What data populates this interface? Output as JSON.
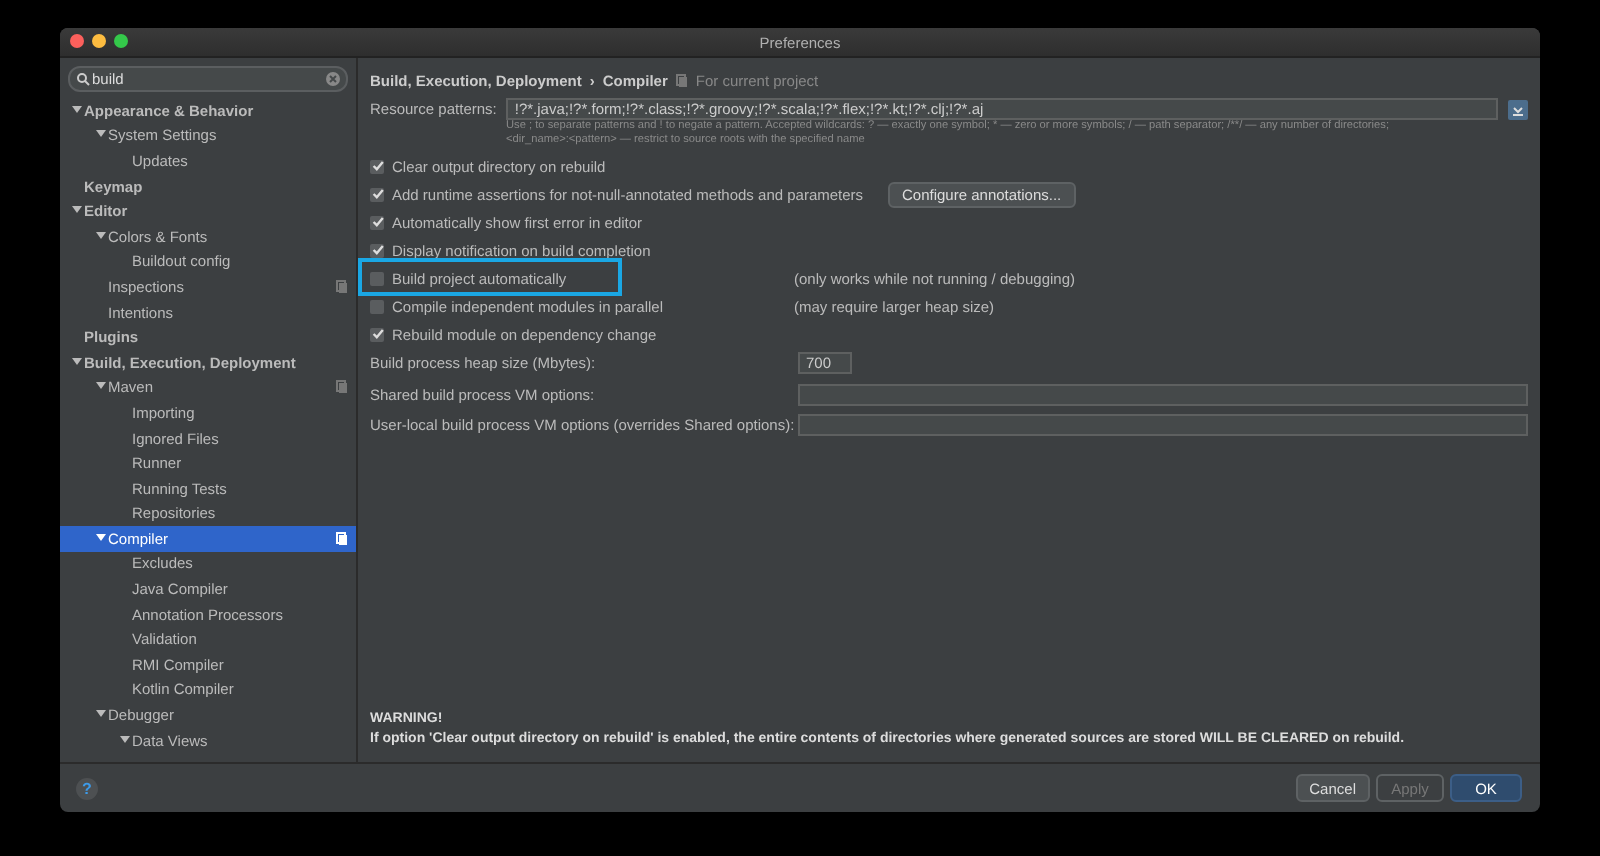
{
  "window": {
    "title": "Preferences"
  },
  "search": {
    "value": "build"
  },
  "tree": [
    {
      "label": "Appearance & Behavior",
      "expanded": true,
      "selected": false,
      "project_icon": false,
      "children": [
        {
          "label": "System Settings",
          "expanded": true,
          "selected": false,
          "project_icon": false,
          "children": [
            {
              "label": "Updates",
              "selected": false,
              "project_icon": false
            }
          ]
        }
      ]
    },
    {
      "label": "Keymap",
      "selected": false,
      "project_icon": false
    },
    {
      "label": "Editor",
      "expanded": true,
      "selected": false,
      "project_icon": false,
      "children": [
        {
          "label": "Colors & Fonts",
          "expanded": true,
          "selected": false,
          "project_icon": false,
          "children": [
            {
              "label": "Buildout config",
              "selected": false,
              "project_icon": false
            }
          ]
        },
        {
          "label": "Inspections",
          "selected": false,
          "project_icon": true
        },
        {
          "label": "Intentions",
          "selected": false,
          "project_icon": false
        }
      ]
    },
    {
      "label": "Plugins",
      "selected": false,
      "project_icon": false
    },
    {
      "label": "Build, Execution, Deployment",
      "expanded": true,
      "selected": false,
      "project_icon": false,
      "children": [
        {
          "label": "Maven",
          "expanded": true,
          "selected": false,
          "project_icon": true,
          "children": [
            {
              "label": "Importing",
              "selected": false,
              "project_icon": false
            },
            {
              "label": "Ignored Files",
              "selected": false,
              "project_icon": false
            },
            {
              "label": "Runner",
              "selected": false,
              "project_icon": false
            },
            {
              "label": "Running Tests",
              "selected": false,
              "project_icon": false
            },
            {
              "label": "Repositories",
              "selected": false,
              "project_icon": false
            }
          ]
        },
        {
          "label": "Compiler",
          "expanded": true,
          "selected": true,
          "project_icon": true,
          "children": [
            {
              "label": "Excludes",
              "selected": false,
              "project_icon": false
            },
            {
              "label": "Java Compiler",
              "selected": false,
              "project_icon": false
            },
            {
              "label": "Annotation Processors",
              "selected": false,
              "project_icon": false
            },
            {
              "label": "Validation",
              "selected": false,
              "project_icon": false
            },
            {
              "label": "RMI Compiler",
              "selected": false,
              "project_icon": false
            },
            {
              "label": "Kotlin Compiler",
              "selected": false,
              "project_icon": false
            }
          ]
        },
        {
          "label": "Debugger",
          "expanded": true,
          "selected": false,
          "project_icon": false,
          "children": [
            {
              "label": "Data Views",
              "expanded": true,
              "selected": false,
              "project_icon": false
            }
          ]
        }
      ]
    }
  ],
  "breadcrumb": {
    "section": "Build, Execution, Deployment",
    "separator": "›",
    "page": "Compiler",
    "scope": "For current project"
  },
  "resource_patterns": {
    "label": "Resource patterns:",
    "value": "!?*.java;!?*.form;!?*.class;!?*.groovy;!?*.scala;!?*.flex;!?*.kt;!?*.clj;!?*.aj",
    "hint": [
      "Use ; to separate patterns and ! to negate a pattern. Accepted wildcards: ? — exactly one symbol; * — zero or more symbols; / — path separator; /**/ — any number of directories;",
      "<dir_name>:<pattern> — restrict to source roots with the specified name"
    ]
  },
  "options": [
    {
      "label": "Clear output directory on rebuild",
      "checked": true,
      "highlighted": false
    },
    {
      "label": "Add runtime assertions for not-null-annotated methods and parameters",
      "checked": true,
      "highlighted": false,
      "button": "Configure annotations..."
    },
    {
      "label": "Automatically show first error in editor",
      "checked": true,
      "highlighted": false
    },
    {
      "label": "Display notification on build completion",
      "checked": true,
      "highlighted": false
    },
    {
      "label": "Build project automatically",
      "checked": false,
      "highlighted": true,
      "note": "(only works while not running / debugging)"
    },
    {
      "label": "Compile independent modules in parallel",
      "checked": false,
      "highlighted": false,
      "note": "(may require larger heap size)"
    },
    {
      "label": "Rebuild module on dependency change",
      "checked": true,
      "highlighted": false
    }
  ],
  "fields": [
    {
      "label": "Build process heap size (Mbytes):",
      "value": "700",
      "kind": "short"
    },
    {
      "label": "Shared build process VM options:",
      "kind": "wide"
    },
    {
      "label": "User-local build process VM options (overrides Shared options):",
      "kind": "wide"
    }
  ],
  "warning": {
    "title": "WARNING!",
    "text": "If option 'Clear output directory on rebuild' is enabled, the entire contents of directories where generated sources are stored **WILL BE CLEARED** on rebuild."
  },
  "buttons": [
    {
      "label": "Cancel",
      "disabled": false,
      "default": false
    },
    {
      "label": "Apply",
      "disabled": true,
      "default": false
    },
    {
      "label": "OK",
      "disabled": false,
      "default": true
    }
  ],
  "help": {
    "label": "?"
  }
}
